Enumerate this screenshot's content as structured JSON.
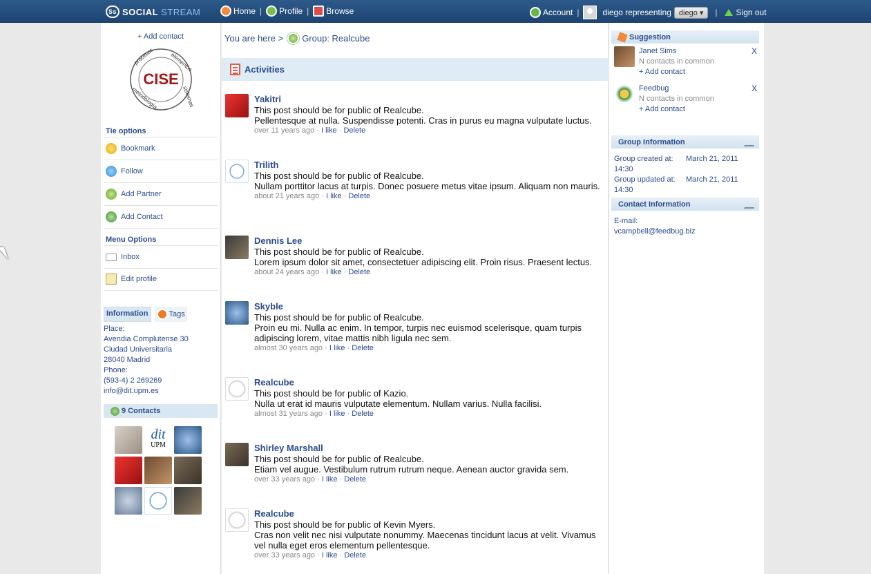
{
  "header": {
    "logo_badge": "Ss",
    "logo_social": "SOCIAL",
    "logo_stream": "STREAM",
    "nav": [
      {
        "label": "Home",
        "icon": "home-icon"
      },
      {
        "label": "Profile",
        "icon": "profile-icon"
      },
      {
        "label": "Browse",
        "icon": "browse-icon"
      }
    ],
    "account_label": "Account",
    "representing": "diego representing",
    "rep_value": "diego",
    "signout_label": "Sign out"
  },
  "left": {
    "add_contact": "+ Add contact",
    "logo_text": "CISE",
    "logo_ring": [
      "procesos",
      "elementos",
      "sistemas",
      "metodología"
    ],
    "tie_options_title": "Tie options",
    "tie_options": [
      {
        "label": "Bookmark",
        "icon": "bookmark-icon"
      },
      {
        "label": "Follow",
        "icon": "follow-icon"
      },
      {
        "label": "Add Partner",
        "icon": "partner-icon"
      },
      {
        "label": "Add Contact",
        "icon": "contact-icon"
      }
    ],
    "menu_options_title": "Menu Options",
    "menu_options": [
      {
        "label": "Inbox",
        "icon": "inbox-icon"
      },
      {
        "label": "Edit profile",
        "icon": "edit-icon"
      }
    ],
    "tab_information": "Information",
    "tab_tags": "Tags",
    "info_lines": [
      "Place:",
      "Avendia Complutense 30",
      "Ciudad Universitaria",
      "28040 Madrid",
      "Phone:",
      "(593-4) 2 269269",
      "info@dit.upm.es"
    ],
    "contacts_title": "9 Contacts"
  },
  "center": {
    "breadcrumb_prefix": "You are here >",
    "breadcrumb_group": "Group: Realcube",
    "activities_title": "Activities",
    "like_label": "I like",
    "delete_label": "Delete",
    "posts": [
      {
        "name": "Yakitri",
        "line1": "This post should be for public of Realcube.",
        "line2": "Pellentesque at nulla. Suspendisse potenti. Cras in purus eu magna vulputate luctus.",
        "time": "over 11 years ago"
      },
      {
        "name": "Trilith",
        "line1": "This post should be for public of Realcube.",
        "line2": "Nullam porttitor lacus at turpis. Donec posuere metus vitae ipsum. Aliquam non mauris.",
        "time": "about 21 years ago"
      },
      {
        "name": "Dennis Lee",
        "line1": "This post should be for public of Realcube.",
        "line2": "Lorem ipsum dolor sit amet, consectetuer adipiscing elit. Proin risus. Praesent lectus.",
        "time": "about 24 years ago"
      },
      {
        "name": "Skyble",
        "line1": "This post should be for public of Realcube.",
        "line2": "Proin eu mi. Nulla ac enim. In tempor, turpis nec euismod scelerisque, quam turpis adipiscing lorem, vitae mattis nibh ligula nec sem.",
        "time": "almost 30 years ago"
      },
      {
        "name": "Realcube",
        "line1": "This post should be for public of Kazio.",
        "line2": "Nulla ut erat id mauris vulputate elementum. Nullam varius. Nulla facilisi.",
        "time": "almost 31 years ago"
      },
      {
        "name": "Shirley Marshall",
        "line1": "This post should be for public of Realcube.",
        "line2": "Etiam vel augue. Vestibulum rutrum rutrum neque. Aenean auctor gravida sem.",
        "time": "over 33 years ago"
      },
      {
        "name": "Realcube",
        "line1": "This post should be for public of Kevin Myers.",
        "line2": "Cras non velit nec nisi vulputate nonummy. Maecenas tincidunt lacus at velit. Vivamus vel nulla eget eros elementum pellentesque.",
        "time": "over 33 years ago"
      }
    ]
  },
  "right": {
    "suggestion_title": "Suggestion",
    "suggestions": [
      {
        "name": "Janet Sims",
        "common": "N contacts in common",
        "add": "+ Add contact",
        "close": "X"
      },
      {
        "name": "Feedbug",
        "common": "N contacts in common",
        "add": "+ Add contact",
        "close": "X"
      }
    ],
    "group_info_title": "Group Information",
    "created_label": "Group created at:",
    "created_value": "March 21, 2011",
    "created_time": "14:30",
    "updated_label": "Group updated at:",
    "updated_value": "March 21, 2011",
    "updated_time": "14:30",
    "contact_info_title": "Contact Information",
    "email_label": "E-mail:",
    "email_value": "vcampbell@feedbug.biz"
  },
  "colors": {
    "header": "#1d4472",
    "link": "#2a4b8d",
    "panel": "#dfecf5"
  }
}
